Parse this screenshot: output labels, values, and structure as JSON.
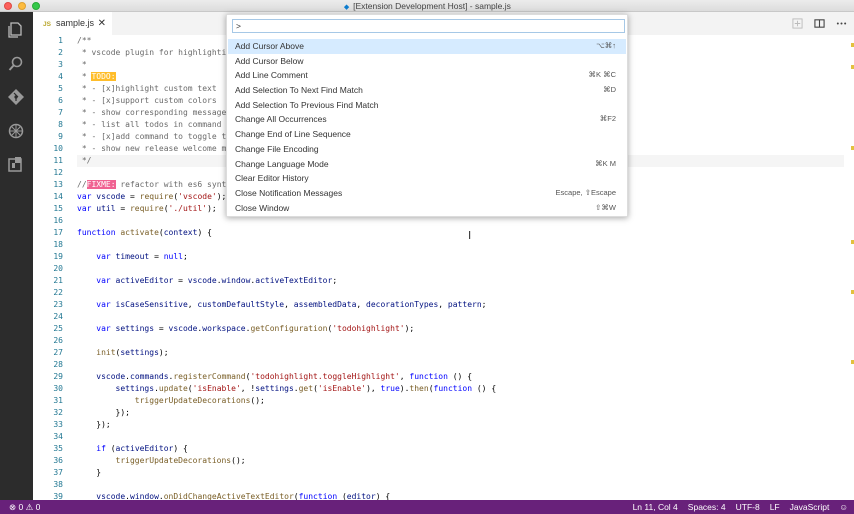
{
  "window": {
    "title": "[Extension Development Host] - sample.js"
  },
  "activity_bar": {
    "icons": [
      "files-icon",
      "search-icon",
      "git-icon",
      "debug-icon",
      "extensions-icon"
    ]
  },
  "tab": {
    "type_badge": "JS",
    "filename": "sample.js",
    "close": "✕"
  },
  "editor_actions": [
    "open-changes-icon",
    "split-editor-icon",
    "more-icon"
  ],
  "command_palette": {
    "input_value": ">",
    "items": [
      {
        "label": "Add Cursor Above",
        "key": "⌥⌘↑"
      },
      {
        "label": "Add Cursor Below",
        "key": ""
      },
      {
        "label": "Add Line Comment",
        "key": "⌘K ⌘C"
      },
      {
        "label": "Add Selection To Next Find Match",
        "key": "⌘D"
      },
      {
        "label": "Add Selection To Previous Find Match",
        "key": ""
      },
      {
        "label": "Change All Occurrences",
        "key": "⌘F2"
      },
      {
        "label": "Change End of Line Sequence",
        "key": ""
      },
      {
        "label": "Change File Encoding",
        "key": ""
      },
      {
        "label": "Change Language Mode",
        "key": "⌘K M"
      },
      {
        "label": "Clear Editor History",
        "key": ""
      },
      {
        "label": "Close Notification Messages",
        "key": "Escape, ⇧Escape"
      },
      {
        "label": "Close Window",
        "key": "⇧⌘W"
      }
    ]
  },
  "code": {
    "line_numbers": [
      "1",
      "2",
      "3",
      "4",
      "5",
      "6",
      "7",
      "8",
      "9",
      "10",
      "11",
      "12",
      "13",
      "14",
      "15",
      "16",
      "17",
      "18",
      "19",
      "20",
      "21",
      "22",
      "23",
      "24",
      "25",
      "26",
      "27",
      "28",
      "29",
      "30",
      "31",
      "32",
      "33",
      "34",
      "35",
      "36",
      "37",
      "38",
      "39"
    ],
    "lines": [
      {
        "s": [
          {
            "t": "/**",
            "c": "c-com"
          }
        ]
      },
      {
        "s": [
          {
            "t": " * vscode plugin for highlighti",
            "c": "c-com"
          }
        ]
      },
      {
        "s": [
          {
            "t": " *",
            "c": "c-com"
          }
        ]
      },
      {
        "s": [
          {
            "t": " * ",
            "c": "c-com"
          },
          {
            "t": "TODO:",
            "c": "hl-todo"
          }
        ]
      },
      {
        "s": [
          {
            "t": " * - [x]highlight custom text",
            "c": "c-com"
          }
        ]
      },
      {
        "s": [
          {
            "t": " * - [x]support custom colors",
            "c": "c-com"
          }
        ]
      },
      {
        "s": [
          {
            "t": " * - show corresponding message",
            "c": "c-com"
          }
        ]
      },
      {
        "s": [
          {
            "t": " * - list all todos in command",
            "c": "c-com"
          }
        ]
      },
      {
        "s": [
          {
            "t": " * - [x]add command to toggle t",
            "c": "c-com"
          }
        ]
      },
      {
        "s": [
          {
            "t": " * - show new release welcome m",
            "c": "c-com"
          }
        ]
      },
      {
        "s": [
          {
            "t": " */",
            "c": "c-com"
          }
        ],
        "cur": true
      },
      {
        "s": [
          {
            "t": "",
            "c": ""
          }
        ]
      },
      {
        "s": [
          {
            "t": "//",
            "c": "c-com"
          },
          {
            "t": "FIXME:",
            "c": "hl-fix"
          },
          {
            "t": " refactor with es6 synt",
            "c": "c-com"
          }
        ]
      },
      {
        "s": [
          {
            "t": "var ",
            "c": "c-kw"
          },
          {
            "t": "vscode",
            "c": "c-var"
          },
          {
            "t": " = ",
            "c": ""
          },
          {
            "t": "require",
            "c": "c-fn"
          },
          {
            "t": "(",
            "c": ""
          },
          {
            "t": "'vscode'",
            "c": "c-str"
          },
          {
            "t": ");",
            "c": ""
          }
        ]
      },
      {
        "s": [
          {
            "t": "var ",
            "c": "c-kw"
          },
          {
            "t": "util",
            "c": "c-var"
          },
          {
            "t": " = ",
            "c": ""
          },
          {
            "t": "require",
            "c": "c-fn"
          },
          {
            "t": "(",
            "c": ""
          },
          {
            "t": "'./util'",
            "c": "c-str"
          },
          {
            "t": ");",
            "c": ""
          }
        ]
      },
      {
        "s": [
          {
            "t": "",
            "c": ""
          }
        ]
      },
      {
        "s": [
          {
            "t": "function ",
            "c": "c-kw"
          },
          {
            "t": "activate",
            "c": "c-fn"
          },
          {
            "t": "(",
            "c": ""
          },
          {
            "t": "context",
            "c": "c-var"
          },
          {
            "t": ") {",
            "c": ""
          }
        ]
      },
      {
        "s": [
          {
            "t": "",
            "c": ""
          }
        ]
      },
      {
        "s": [
          {
            "t": "    var ",
            "c": "c-kw"
          },
          {
            "t": "timeout",
            "c": "c-var"
          },
          {
            "t": " = ",
            "c": ""
          },
          {
            "t": "null",
            "c": "c-kw"
          },
          {
            "t": ";",
            "c": ""
          }
        ]
      },
      {
        "s": [
          {
            "t": "",
            "c": ""
          }
        ]
      },
      {
        "s": [
          {
            "t": "    var ",
            "c": "c-kw"
          },
          {
            "t": "activeEditor",
            "c": "c-var"
          },
          {
            "t": " = ",
            "c": ""
          },
          {
            "t": "vscode",
            "c": "c-var"
          },
          {
            "t": ".",
            "c": ""
          },
          {
            "t": "window",
            "c": "c-var"
          },
          {
            "t": ".",
            "c": ""
          },
          {
            "t": "activeTextEditor",
            "c": "c-var"
          },
          {
            "t": ";",
            "c": ""
          }
        ]
      },
      {
        "s": [
          {
            "t": "",
            "c": ""
          }
        ]
      },
      {
        "s": [
          {
            "t": "    var ",
            "c": "c-kw"
          },
          {
            "t": "isCaseSensitive",
            "c": "c-var"
          },
          {
            "t": ", ",
            "c": ""
          },
          {
            "t": "customDefaultStyle",
            "c": "c-var"
          },
          {
            "t": ", ",
            "c": ""
          },
          {
            "t": "assembledData",
            "c": "c-var"
          },
          {
            "t": ", ",
            "c": ""
          },
          {
            "t": "decorationTypes",
            "c": "c-var"
          },
          {
            "t": ", ",
            "c": ""
          },
          {
            "t": "pattern",
            "c": "c-var"
          },
          {
            "t": ";",
            "c": ""
          }
        ]
      },
      {
        "s": [
          {
            "t": "",
            "c": ""
          }
        ]
      },
      {
        "s": [
          {
            "t": "    var ",
            "c": "c-kw"
          },
          {
            "t": "settings",
            "c": "c-var"
          },
          {
            "t": " = ",
            "c": ""
          },
          {
            "t": "vscode",
            "c": "c-var"
          },
          {
            "t": ".",
            "c": ""
          },
          {
            "t": "workspace",
            "c": "c-var"
          },
          {
            "t": ".",
            "c": ""
          },
          {
            "t": "getConfiguration",
            "c": "c-fn"
          },
          {
            "t": "(",
            "c": ""
          },
          {
            "t": "'todohighlight'",
            "c": "c-str"
          },
          {
            "t": ");",
            "c": ""
          }
        ]
      },
      {
        "s": [
          {
            "t": "",
            "c": ""
          }
        ]
      },
      {
        "s": [
          {
            "t": "    ",
            "c": ""
          },
          {
            "t": "init",
            "c": "c-fn"
          },
          {
            "t": "(",
            "c": ""
          },
          {
            "t": "settings",
            "c": "c-var"
          },
          {
            "t": ");",
            "c": ""
          }
        ]
      },
      {
        "s": [
          {
            "t": "",
            "c": ""
          }
        ]
      },
      {
        "s": [
          {
            "t": "    ",
            "c": ""
          },
          {
            "t": "vscode",
            "c": "c-var"
          },
          {
            "t": ".",
            "c": ""
          },
          {
            "t": "commands",
            "c": "c-var"
          },
          {
            "t": ".",
            "c": ""
          },
          {
            "t": "registerCommand",
            "c": "c-fn"
          },
          {
            "t": "(",
            "c": ""
          },
          {
            "t": "'todohighlight.toggleHighlight'",
            "c": "c-str"
          },
          {
            "t": ", ",
            "c": ""
          },
          {
            "t": "function",
            "c": "c-kw"
          },
          {
            "t": " () {",
            "c": ""
          }
        ]
      },
      {
        "s": [
          {
            "t": "        ",
            "c": ""
          },
          {
            "t": "settings",
            "c": "c-var"
          },
          {
            "t": ".",
            "c": ""
          },
          {
            "t": "update",
            "c": "c-fn"
          },
          {
            "t": "(",
            "c": ""
          },
          {
            "t": "'isEnable'",
            "c": "c-str"
          },
          {
            "t": ", !",
            "c": ""
          },
          {
            "t": "settings",
            "c": "c-var"
          },
          {
            "t": ".",
            "c": ""
          },
          {
            "t": "get",
            "c": "c-fn"
          },
          {
            "t": "(",
            "c": ""
          },
          {
            "t": "'isEnable'",
            "c": "c-str"
          },
          {
            "t": "), ",
            "c": ""
          },
          {
            "t": "true",
            "c": "c-kw"
          },
          {
            "t": ").",
            "c": ""
          },
          {
            "t": "then",
            "c": "c-fn"
          },
          {
            "t": "(",
            "c": ""
          },
          {
            "t": "function",
            "c": "c-kw"
          },
          {
            "t": " () {",
            "c": ""
          }
        ]
      },
      {
        "s": [
          {
            "t": "            ",
            "c": ""
          },
          {
            "t": "triggerUpdateDecorations",
            "c": "c-fn"
          },
          {
            "t": "();",
            "c": ""
          }
        ]
      },
      {
        "s": [
          {
            "t": "        });",
            "c": ""
          }
        ]
      },
      {
        "s": [
          {
            "t": "    });",
            "c": ""
          }
        ]
      },
      {
        "s": [
          {
            "t": "",
            "c": ""
          }
        ]
      },
      {
        "s": [
          {
            "t": "    if ",
            "c": "c-kw"
          },
          {
            "t": "(",
            "c": ""
          },
          {
            "t": "activeEditor",
            "c": "c-var"
          },
          {
            "t": ") {",
            "c": ""
          }
        ]
      },
      {
        "s": [
          {
            "t": "        ",
            "c": ""
          },
          {
            "t": "triggerUpdateDecorations",
            "c": "c-fn"
          },
          {
            "t": "();",
            "c": ""
          }
        ]
      },
      {
        "s": [
          {
            "t": "    }",
            "c": ""
          }
        ]
      },
      {
        "s": [
          {
            "t": "",
            "c": ""
          }
        ]
      },
      {
        "s": [
          {
            "t": "    ",
            "c": ""
          },
          {
            "t": "vscode",
            "c": "c-var"
          },
          {
            "t": ".",
            "c": ""
          },
          {
            "t": "window",
            "c": "c-var"
          },
          {
            "t": ".",
            "c": ""
          },
          {
            "t": "onDidChangeActiveTextEditor",
            "c": "c-fn"
          },
          {
            "t": "(",
            "c": ""
          },
          {
            "t": "function",
            "c": "c-kw"
          },
          {
            "t": " (",
            "c": ""
          },
          {
            "t": "editor",
            "c": "c-var"
          },
          {
            "t": ") {",
            "c": ""
          }
        ]
      }
    ]
  },
  "status_bar": {
    "errors": "⊗ 0",
    "warnings": "⚠ 0",
    "position": "Ln 11, Col 4",
    "spaces": "Spaces: 4",
    "encoding": "UTF-8",
    "eol": "LF",
    "language": "JavaScript",
    "feedback": "☺"
  },
  "colors": {
    "status_bar": "#68217a",
    "todo_highlight": "#ffbd2a",
    "fixme_highlight": "#f06292",
    "activity_bar": "#2c2c2c"
  }
}
